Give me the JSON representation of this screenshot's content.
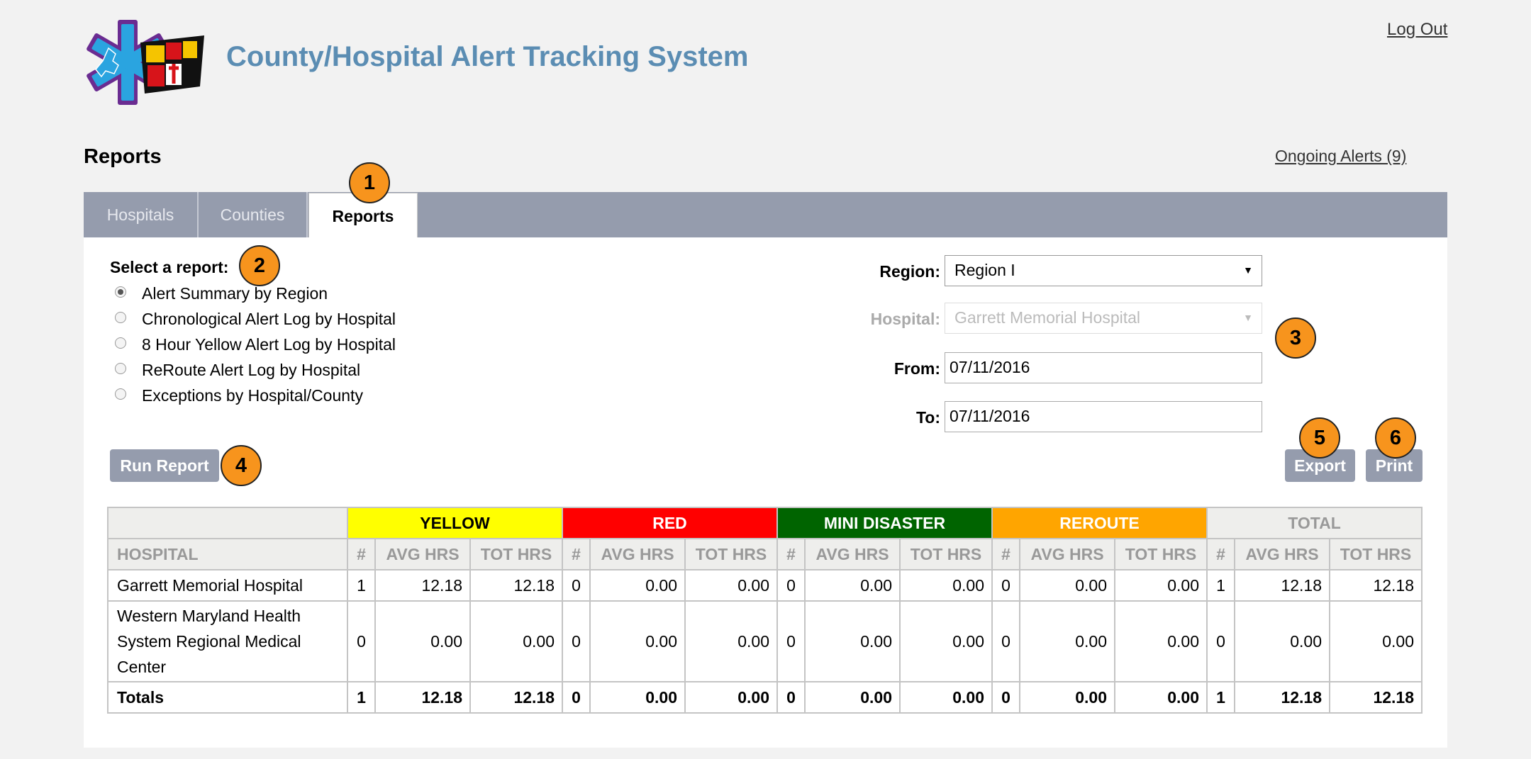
{
  "app": {
    "title": "County/Hospital Alert Tracking System",
    "logout_label": "Log Out"
  },
  "page": {
    "title": "Reports",
    "ongoing_alerts_label": "Ongoing Alerts (9)"
  },
  "tabs": [
    {
      "label": "Hospitals"
    },
    {
      "label": "Counties"
    },
    {
      "label": "Reports",
      "active": true
    }
  ],
  "report_select": {
    "label": "Select a report:",
    "options": [
      {
        "label": "Alert Summary by Region",
        "selected": true
      },
      {
        "label": "Chronological Alert Log by Hospital",
        "selected": false
      },
      {
        "label": "8 Hour Yellow Alert Log by Hospital",
        "selected": false
      },
      {
        "label": "ReRoute Alert Log by Hospital",
        "selected": false
      },
      {
        "label": "Exceptions by Hospital/County",
        "selected": false
      }
    ]
  },
  "filters": {
    "region_label": "Region:",
    "region_value": "Region I",
    "hospital_label": "Hospital:",
    "hospital_value": "Garrett Memorial Hospital",
    "from_label": "From:",
    "from_value": "07/11/2016",
    "to_label": "To:",
    "to_value": "07/11/2016"
  },
  "buttons": {
    "run_report": "Run Report",
    "export": "Export",
    "print": "Print"
  },
  "callouts": [
    "1",
    "2",
    "3",
    "4",
    "5",
    "6"
  ],
  "table": {
    "groups": [
      {
        "label": "YELLOW",
        "bg": "#ffff00",
        "fg": "#000000"
      },
      {
        "label": "RED",
        "bg": "#ff0000",
        "fg": "#ffffff"
      },
      {
        "label": "MINI DISASTER",
        "bg": "#006400",
        "fg": "#ffffff"
      },
      {
        "label": "REROUTE",
        "bg": "#ffa500",
        "fg": "#ffffff"
      },
      {
        "label": "TOTAL",
        "bg": "#eeeeec",
        "fg": "#999999"
      }
    ],
    "hospital_header": "HOSPITAL",
    "sub_headers": [
      "#",
      "AVG HRS",
      "TOT HRS"
    ],
    "rows": [
      {
        "hospital": "Garrett Memorial Hospital",
        "cells": [
          "1",
          "12.18",
          "12.18",
          "0",
          "0.00",
          "0.00",
          "0",
          "0.00",
          "0.00",
          "0",
          "0.00",
          "0.00",
          "1",
          "12.18",
          "12.18"
        ]
      },
      {
        "hospital": "Western Maryland Health System Regional Medical Center",
        "cells": [
          "0",
          "0.00",
          "0.00",
          "0",
          "0.00",
          "0.00",
          "0",
          "0.00",
          "0.00",
          "0",
          "0.00",
          "0.00",
          "0",
          "0.00",
          "0.00"
        ]
      }
    ],
    "totals": {
      "label": "Totals",
      "cells": [
        "1",
        "12.18",
        "12.18",
        "0",
        "0.00",
        "0.00",
        "0",
        "0.00",
        "0.00",
        "0",
        "0.00",
        "0.00",
        "1",
        "12.18",
        "12.18"
      ]
    }
  }
}
